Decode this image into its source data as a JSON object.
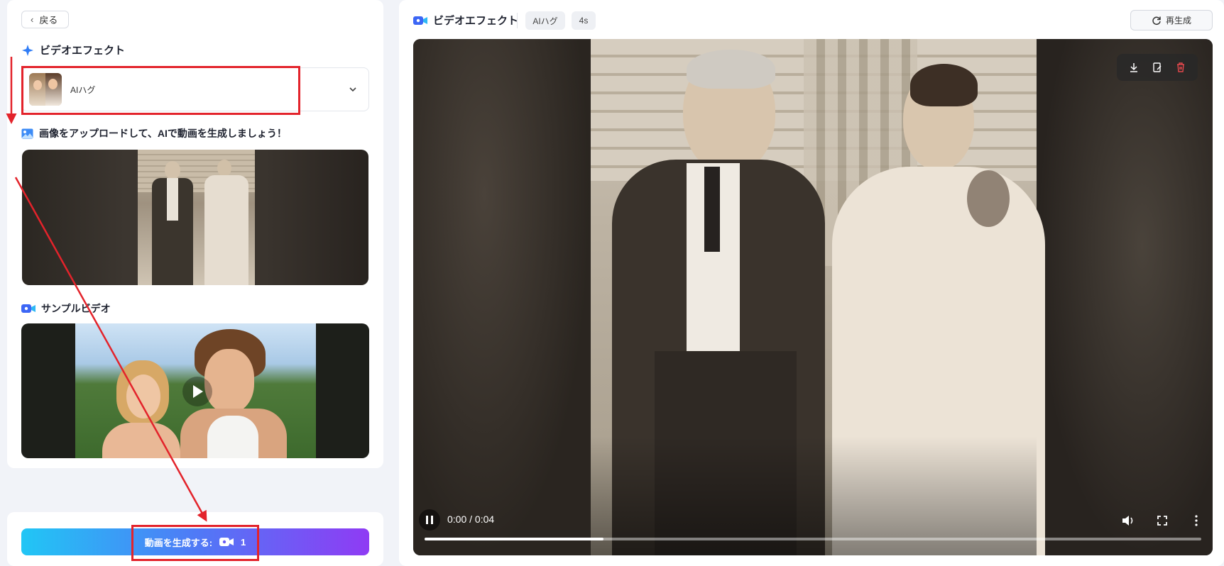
{
  "left_panel": {
    "back_label": "戻る",
    "effect_section_title": "ビデオエフェクト",
    "selected_effect": "AIハグ",
    "upload_prompt": "画像をアップロードして、AIで動画を生成しましょう！",
    "sample_section_title": "サンプルビデオ",
    "generate_label": "動画を生成する:",
    "generate_credits": "1"
  },
  "right_panel": {
    "title": "ビデオエフェクト",
    "tags": [
      "AIハグ",
      "4s"
    ],
    "regenerate_label": "再生成",
    "actions": [
      "download-icon",
      "edit-icon",
      "delete-icon"
    ]
  },
  "player": {
    "time_display": "0:00 / 0:04",
    "progress_fraction": 0.23,
    "state": "playing",
    "controls": [
      "pause-icon",
      "volume-icon",
      "fullscreen-icon",
      "more-options-icon"
    ]
  },
  "colors": {
    "accent_gradient": [
      "#21c6f5",
      "#4f7af6",
      "#8f3bf4"
    ],
    "highlight_red": "#e3232b",
    "delete_red": "#e5484d",
    "sparkle_blue": "#2f7cf6"
  }
}
